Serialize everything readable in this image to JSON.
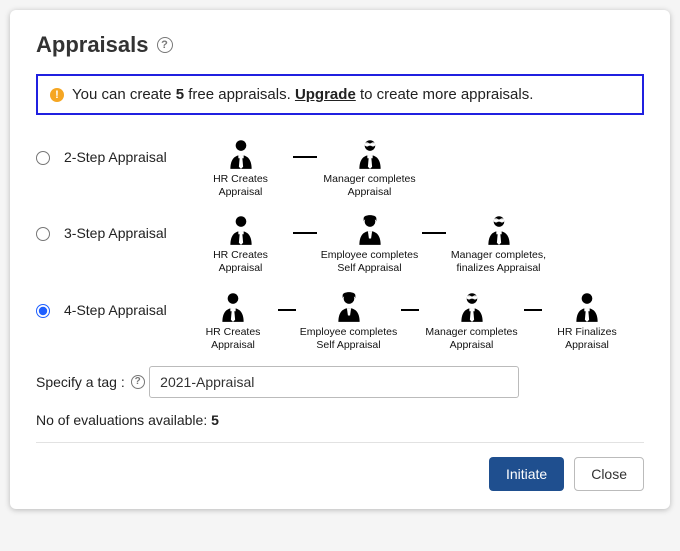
{
  "header": {
    "title": "Appraisals"
  },
  "banner": {
    "text1": "You can create ",
    "count": "5",
    "text2": " free appraisals. ",
    "upgrade": "Upgrade",
    "text3": " to create more appraisals."
  },
  "options": {
    "step2": {
      "label": "2-Step Appraisal",
      "s1": "HR Creates\nAppraisal",
      "s2": "Manager completes\nAppraisal"
    },
    "step3": {
      "label": "3-Step Appraisal",
      "s1": "HR Creates\nAppraisal",
      "s2": "Employee completes\nSelf Appraisal",
      "s3": "Manager completes,\nfinalizes Appraisal"
    },
    "step4": {
      "label": "4-Step Appraisal",
      "s1": "HR Creates\nAppraisal",
      "s2": "Employee completes\nSelf Appraisal",
      "s3": "Manager completes\nAppraisal",
      "s4": "HR Finalizes\nAppraisal"
    }
  },
  "tag": {
    "label": "Specify a tag :",
    "value": "2021-Appraisal"
  },
  "evaluations": {
    "label": "No of evaluations available: ",
    "count": "5"
  },
  "buttons": {
    "initiate": "Initiate",
    "close": "Close"
  }
}
